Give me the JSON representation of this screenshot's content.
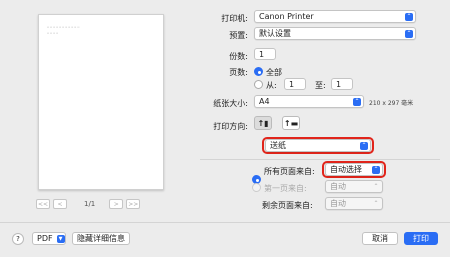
{
  "preview": {
    "line1": "▫▫▫▫▫▫▫▫▫▫▫",
    "line2": "▫▫▫▫",
    "first": "<<",
    "prev": "<",
    "page_count": "1/1",
    "next": ">",
    "last": ">>"
  },
  "printer": {
    "label": "打印机:",
    "value": "Canon Printer"
  },
  "presets": {
    "label": "预置:",
    "value": "默认设置"
  },
  "copies": {
    "label": "份数:",
    "value": "1"
  },
  "pages": {
    "label": "页数:",
    "all_label": "全部",
    "from_label": "从:",
    "from_value": "1",
    "to_label": "至:",
    "to_value": "1"
  },
  "paper_size": {
    "label": "纸张大小:",
    "value": "A4",
    "dims": "210 x 297 毫米"
  },
  "orientation": {
    "label": "打印方向:",
    "portrait_glyph": "↑▮",
    "landscape_glyph": "↑▬"
  },
  "section": {
    "value": "送纸"
  },
  "feed": {
    "all_pages_label": "所有页面来自:",
    "all_pages_value": "自动选择",
    "first_page_label": "第一页来自:",
    "first_page_value": "自动",
    "remaining_label": "剩余页面来自:",
    "remaining_value": "自动"
  },
  "footer": {
    "help": "?",
    "pdf_label": "PDF",
    "hide_details": "隐藏详细信息",
    "cancel": "取消",
    "print": "打印"
  },
  "colors": {
    "accent": "#2a6df4",
    "highlight": "#e1251b"
  },
  "icons": {
    "caret": "popup-caret-icon",
    "help": "help-icon"
  }
}
